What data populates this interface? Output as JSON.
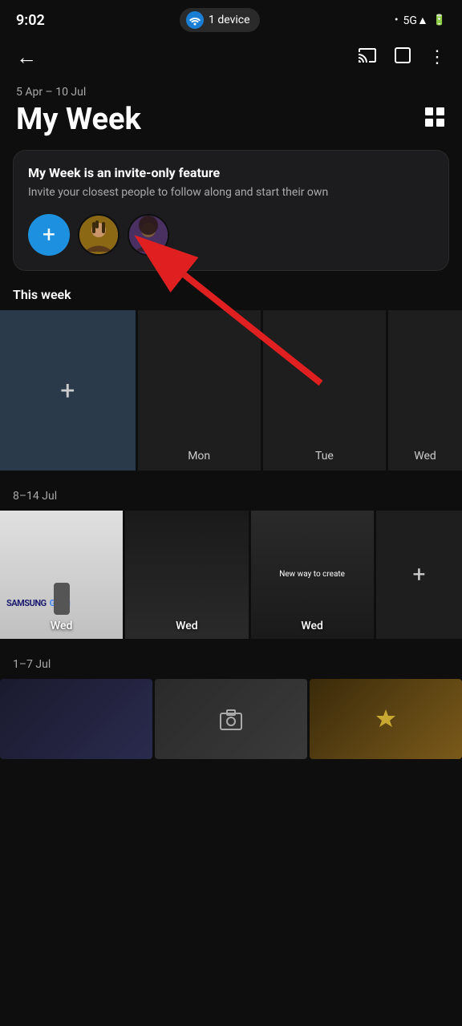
{
  "status": {
    "time": "9:02",
    "device_label": "1 device",
    "battery": "100"
  },
  "nav": {
    "back_icon": "←",
    "cast_icon": "⬛",
    "window_icon": "⬜",
    "more_icon": "⋮"
  },
  "header": {
    "date_range": "5 Apr – 10 Jul",
    "title": "My Week",
    "grid_icon": "⊞"
  },
  "invite_card": {
    "title": "My Week is an invite-only feature",
    "description": "Invite your closest people to follow along and start their own",
    "add_button_label": "+",
    "avatars": [
      {
        "id": 1,
        "label": "avatar-1"
      },
      {
        "id": 2,
        "label": "avatar-2"
      }
    ]
  },
  "this_week": {
    "section_label": "This week",
    "days": [
      {
        "label": "",
        "type": "add"
      },
      {
        "label": "Mon",
        "type": "empty"
      },
      {
        "label": "Tue",
        "type": "empty"
      },
      {
        "label": "Wed",
        "type": "partial"
      }
    ]
  },
  "week_8_14": {
    "section_label": "8–14 Jul",
    "photos": [
      {
        "label": "Wed",
        "type": "samsung"
      },
      {
        "label": "Wed",
        "type": "dark"
      },
      {
        "label": "Wed",
        "type": "new-way"
      },
      {
        "label": "+",
        "type": "plus"
      }
    ]
  },
  "week_1_7": {
    "section_label": "1–7 Jul",
    "photos": [
      {
        "type": "dark"
      },
      {
        "type": "gray"
      },
      {
        "type": "gold"
      }
    ]
  }
}
